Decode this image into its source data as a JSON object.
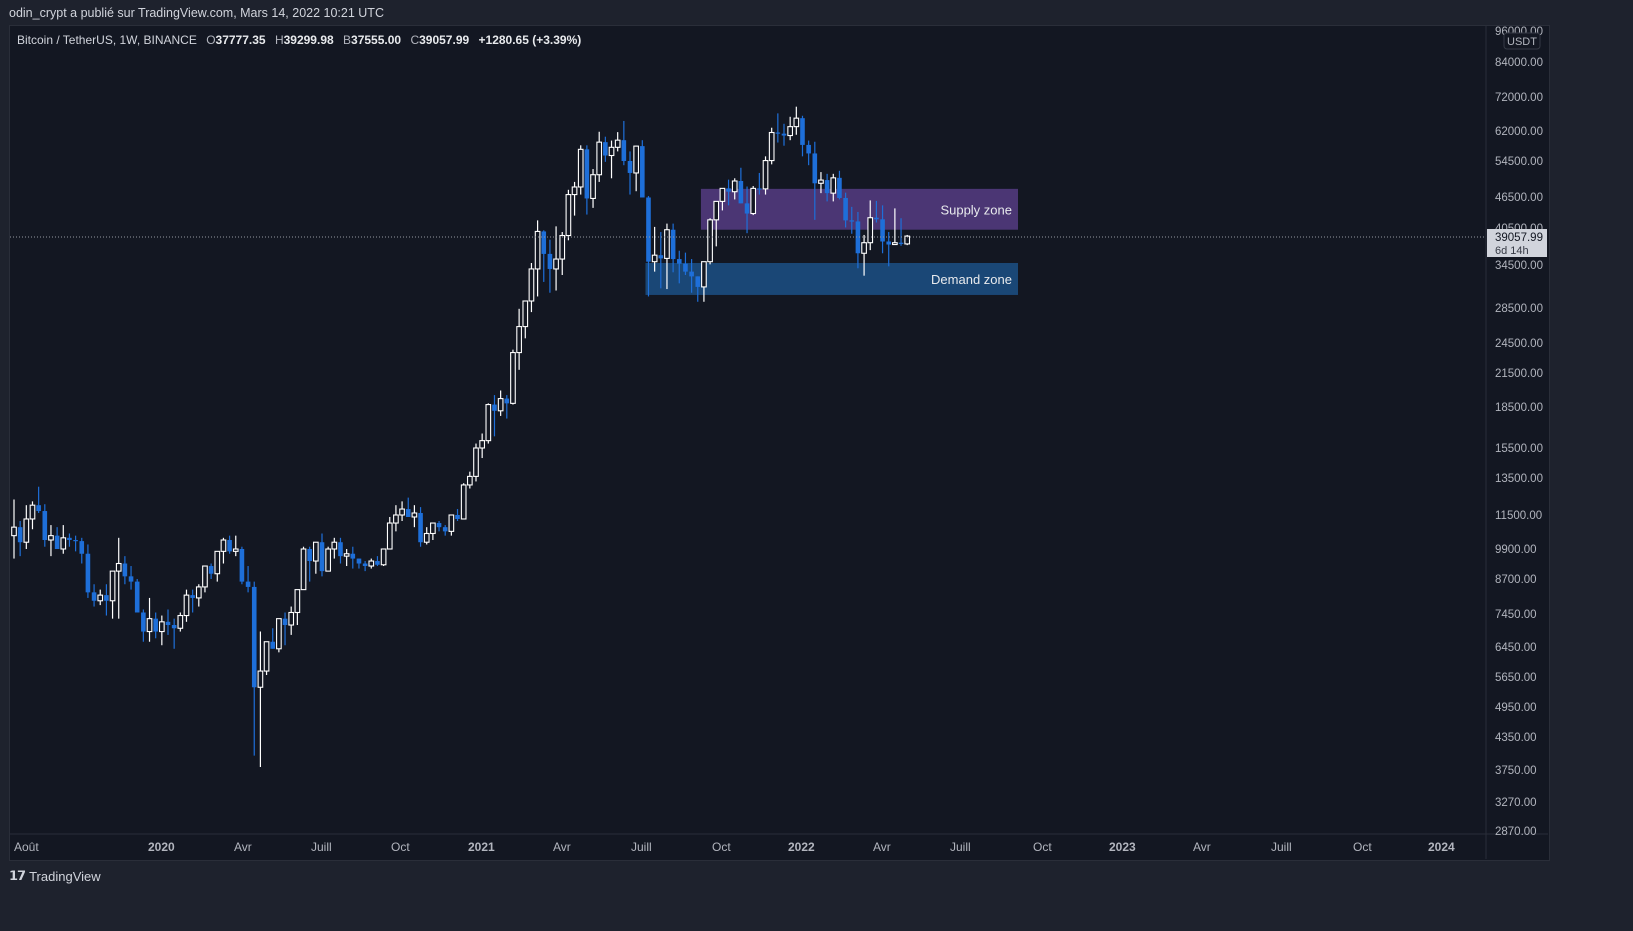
{
  "header": {
    "published_by": "odin_crypt a publié sur TradingView.com, Mars 14, 2022 10:21 UTC"
  },
  "legend": {
    "symbol": "Bitcoin / TetherUS, 1W, BINANCE",
    "open_label": "O",
    "open": "37777.35",
    "high_label": "H",
    "high": "39299.98",
    "low_label": "B",
    "low": "37555.00",
    "close_label": "C",
    "close": "39057.99",
    "change": "+1280.65 (+3.39%)"
  },
  "price_axis": {
    "currency": "USDT",
    "current_price": "39057.99",
    "countdown": "6d 14h"
  },
  "footer": {
    "brand": "TradingView"
  },
  "colors": {
    "up": "#ffffff",
    "down": "#1e6fd9",
    "supply": "#4b3674",
    "demand": "#1a4776",
    "background": "#131722"
  },
  "chart_data": {
    "type": "candlestick",
    "title": "Bitcoin / TetherUS, 1W, BINANCE",
    "scale": "log",
    "ylim": [
      2870,
      96000
    ],
    "y_ticks": [
      "96000.00",
      "84000.00",
      "72000.00",
      "62000.00",
      "54500.00",
      "46500.00",
      "40500.00",
      "34500.00",
      "28500.00",
      "24500.00",
      "21500.00",
      "18500.00",
      "15500.00",
      "13500.00",
      "11500.00",
      "9900.00",
      "8700.00",
      "7450.00",
      "6450.00",
      "5650.00",
      "4950.00",
      "4350.00",
      "3750.00",
      "3270.00",
      "2870.00"
    ],
    "x_ticks": [
      "Août",
      "2020",
      "Avr",
      "Juill",
      "Oct",
      "2021",
      "Avr",
      "Juill",
      "Oct",
      "2022",
      "Avr",
      "Juill",
      "Oct",
      "2023",
      "Avr",
      "Juill",
      "Oct",
      "2024"
    ],
    "current_price": 39057.99,
    "zones": [
      {
        "label": "Supply zone",
        "from": 40200,
        "to": 48200,
        "start_week": 112
      },
      {
        "label": "Demand zone",
        "from": 30200,
        "to": 34800,
        "start_week": 103
      }
    ],
    "candles": [
      [
        10500,
        12300,
        9500,
        10900
      ],
      [
        10900,
        11200,
        9600,
        10200
      ],
      [
        10200,
        12000,
        9900,
        11300
      ],
      [
        11300,
        12200,
        10800,
        12000
      ],
      [
        12000,
        13000,
        11600,
        11700
      ],
      [
        11700,
        12050,
        10000,
        10300
      ],
      [
        10300,
        11000,
        9600,
        10500
      ],
      [
        10500,
        10900,
        9900,
        9900
      ],
      [
        9900,
        11000,
        9700,
        10400
      ],
      [
        10400,
        10600,
        10000,
        10300
      ],
      [
        10300,
        10500,
        9800,
        10250
      ],
      [
        10250,
        10400,
        9300,
        9700
      ],
      [
        9700,
        10100,
        8000,
        8200
      ],
      [
        8200,
        8500,
        7700,
        7900
      ],
      [
        7900,
        8300,
        7750,
        8100
      ],
      [
        8100,
        8500,
        7400,
        7900
      ],
      [
        7900,
        8900,
        7300,
        9000
      ],
      [
        9000,
        10400,
        7300,
        9300
      ],
      [
        9300,
        9600,
        8500,
        8800
      ],
      [
        8800,
        9200,
        8300,
        8600
      ],
      [
        8600,
        8700,
        7600,
        7500
      ],
      [
        7500,
        7600,
        6600,
        6900
      ],
      [
        6900,
        8000,
        6600,
        7300
      ],
      [
        7300,
        7500,
        6700,
        6900
      ],
      [
        6900,
        7400,
        6500,
        7200
      ],
      [
        7200,
        7600,
        6800,
        7100
      ],
      [
        7100,
        7300,
        6400,
        7000
      ],
      [
        7000,
        7500,
        6900,
        7400
      ],
      [
        7400,
        8300,
        7200,
        8100
      ],
      [
        8100,
        8300,
        7500,
        8000
      ],
      [
        8000,
        8500,
        7700,
        8400
      ],
      [
        8400,
        9200,
        8200,
        9200
      ],
      [
        9200,
        9300,
        8700,
        8900
      ],
      [
        8900,
        9800,
        8600,
        9800
      ],
      [
        9800,
        10400,
        9300,
        10300
      ],
      [
        10300,
        10500,
        9700,
        9800
      ],
      [
        9800,
        10500,
        9600,
        9900
      ],
      [
        9900,
        10000,
        8500,
        8600
      ],
      [
        8600,
        9200,
        8200,
        8400
      ],
      [
        8400,
        8600,
        4000,
        5400
      ],
      [
        5400,
        6900,
        3800,
        5800
      ],
      [
        5800,
        6600,
        5700,
        6600
      ],
      [
        6600,
        7000,
        6400,
        6400
      ],
      [
        6400,
        7300,
        6300,
        7300
      ],
      [
        7300,
        7500,
        6500,
        7100
      ],
      [
        7100,
        7700,
        6800,
        7500
      ],
      [
        7500,
        8100,
        7100,
        8300
      ],
      [
        8300,
        10000,
        8500,
        9900
      ],
      [
        9900,
        10000,
        8600,
        9400
      ],
      [
        9400,
        10100,
        8900,
        10200
      ],
      [
        10200,
        10600,
        8800,
        9000
      ],
      [
        9000,
        10000,
        9000,
        9900
      ],
      [
        9900,
        10400,
        9500,
        10200
      ],
      [
        10200,
        10400,
        9300,
        9600
      ],
      [
        9600,
        9900,
        9200,
        9700
      ],
      [
        9700,
        10000,
        9100,
        9500
      ],
      [
        9500,
        9500,
        9100,
        9300
      ],
      [
        9300,
        9400,
        9000,
        9200
      ],
      [
        9200,
        9500,
        9100,
        9400
      ],
      [
        9400,
        9600,
        9200,
        9250
      ],
      [
        9250,
        9900,
        9200,
        9900
      ],
      [
        9900,
        11400,
        9900,
        11100
      ],
      [
        11100,
        12000,
        10700,
        11500
      ],
      [
        11500,
        12200,
        11200,
        11800
      ],
      [
        11800,
        12400,
        11500,
        11400
      ],
      [
        11400,
        12000,
        10900,
        11600
      ],
      [
        11600,
        11900,
        10000,
        10200
      ],
      [
        10200,
        10900,
        10100,
        10600
      ],
      [
        10600,
        11100,
        10300,
        11100
      ],
      [
        11100,
        11200,
        10700,
        10900
      ],
      [
        10900,
        11000,
        10500,
        10700
      ],
      [
        10700,
        11400,
        10500,
        11500
      ],
      [
        11500,
        11800,
        11200,
        11300
      ],
      [
        11300,
        13200,
        11300,
        13100
      ],
      [
        13100,
        13900,
        12900,
        13600
      ],
      [
        13600,
        15800,
        13300,
        15500
      ],
      [
        15500,
        16500,
        14800,
        16000
      ],
      [
        16000,
        18800,
        15800,
        18700
      ],
      [
        18700,
        19500,
        16300,
        18200
      ],
      [
        18200,
        19900,
        17800,
        19200
      ],
      [
        19200,
        19500,
        17600,
        18800
      ],
      [
        18800,
        23800,
        18700,
        23500
      ],
      [
        23500,
        28400,
        21800,
        26300
      ],
      [
        26300,
        29300,
        25000,
        29400
      ],
      [
        29400,
        34800,
        28000,
        33900
      ],
      [
        33900,
        41900,
        30000,
        39900
      ],
      [
        39900,
        40100,
        32000,
        36200
      ],
      [
        36200,
        38500,
        30500,
        33900
      ],
      [
        33900,
        40800,
        30800,
        35400
      ],
      [
        35400,
        39800,
        33000,
        39200
      ],
      [
        39200,
        48000,
        38400,
        47000
      ],
      [
        47000,
        49700,
        42800,
        48600
      ],
      [
        48600,
        58300,
        47000,
        57300
      ],
      [
        57300,
        58300,
        43000,
        46200
      ],
      [
        46200,
        52600,
        44300,
        51300
      ],
      [
        51300,
        61800,
        49700,
        59100
      ],
      [
        59100,
        60500,
        54300,
        55800
      ],
      [
        55800,
        59500,
        50500,
        57800
      ],
      [
        57800,
        61700,
        56800,
        59600
      ],
      [
        59600,
        64800,
        53500,
        54500
      ],
      [
        54500,
        56800,
        47000,
        51700
      ],
      [
        51700,
        58200,
        47700,
        58100
      ],
      [
        58100,
        59600,
        46900,
        46400
      ],
      [
        46400,
        46700,
        30000,
        35000
      ],
      [
        35000,
        40700,
        33500,
        36000
      ],
      [
        36000,
        39800,
        31100,
        35500
      ],
      [
        35500,
        41300,
        31000,
        40200
      ],
      [
        40200,
        41300,
        33400,
        35400
      ],
      [
        35400,
        36700,
        31800,
        34700
      ],
      [
        34700,
        36400,
        33000,
        33500
      ],
      [
        33500,
        35400,
        30500,
        32800
      ],
      [
        32800,
        32600,
        29300,
        31300
      ],
      [
        31300,
        34400,
        29300,
        35000
      ],
      [
        35000,
        42300,
        34600,
        42000
      ],
      [
        42000,
        45300,
        37400,
        45600
      ],
      [
        45600,
        48200,
        43800,
        48300
      ],
      [
        48300,
        50200,
        44800,
        47600
      ],
      [
        47600,
        50500,
        46000,
        49900
      ],
      [
        49900,
        52900,
        48000,
        45200
      ],
      [
        45200,
        48700,
        39600,
        43200
      ],
      [
        43200,
        48800,
        42900,
        48300
      ],
      [
        48300,
        51700,
        47000,
        48200
      ],
      [
        48200,
        55600,
        47000,
        54600
      ],
      [
        54600,
        62900,
        53700,
        61600
      ],
      [
        61600,
        67000,
        59000,
        61300
      ],
      [
        61300,
        64000,
        58200,
        60800
      ],
      [
        60800,
        66000,
        59600,
        63200
      ],
      [
        63200,
        69000,
        61000,
        65600
      ],
      [
        65600,
        66300,
        55600,
        58400
      ],
      [
        58400,
        59500,
        53500,
        56300
      ],
      [
        56300,
        59200,
        42000,
        49400
      ],
      [
        49400,
        51900,
        47300,
        50100
      ],
      [
        50100,
        51500,
        45600,
        47300
      ],
      [
        47300,
        51500,
        45600,
        50600
      ],
      [
        50600,
        52200,
        46000,
        46300
      ],
      [
        46300,
        47400,
        40600,
        41900
      ],
      [
        41900,
        44500,
        39500,
        41700
      ],
      [
        41700,
        43500,
        34000,
        36300
      ],
      [
        36300,
        39300,
        32900,
        38000
      ],
      [
        38000,
        45800,
        36800,
        42400
      ],
      [
        42400,
        45700,
        41500,
        42100
      ],
      [
        42100,
        44800,
        36300,
        38200
      ],
      [
        38200,
        39800,
        34300,
        37700
      ],
      [
        37700,
        44200,
        37700,
        38000
      ],
      [
        38000,
        42300,
        37500,
        37800
      ],
      [
        37800,
        39300,
        37600,
        39100
      ]
    ]
  }
}
